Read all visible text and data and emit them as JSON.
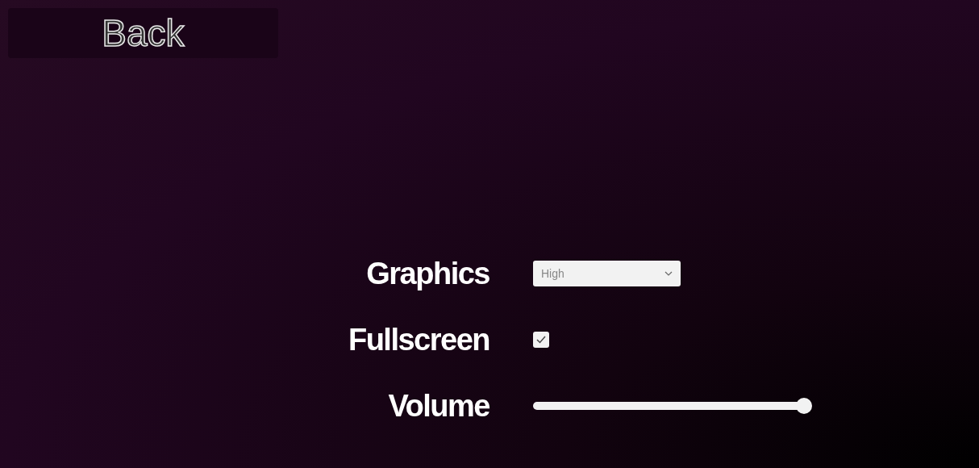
{
  "back_button": {
    "label": "Back"
  },
  "settings": [
    {
      "kind": "dropdown",
      "label": "Graphics",
      "value": "High"
    },
    {
      "kind": "checkbox",
      "label": "Fullscreen",
      "checked": true
    },
    {
      "kind": "slider",
      "label": "Volume",
      "level": 1
    }
  ]
}
